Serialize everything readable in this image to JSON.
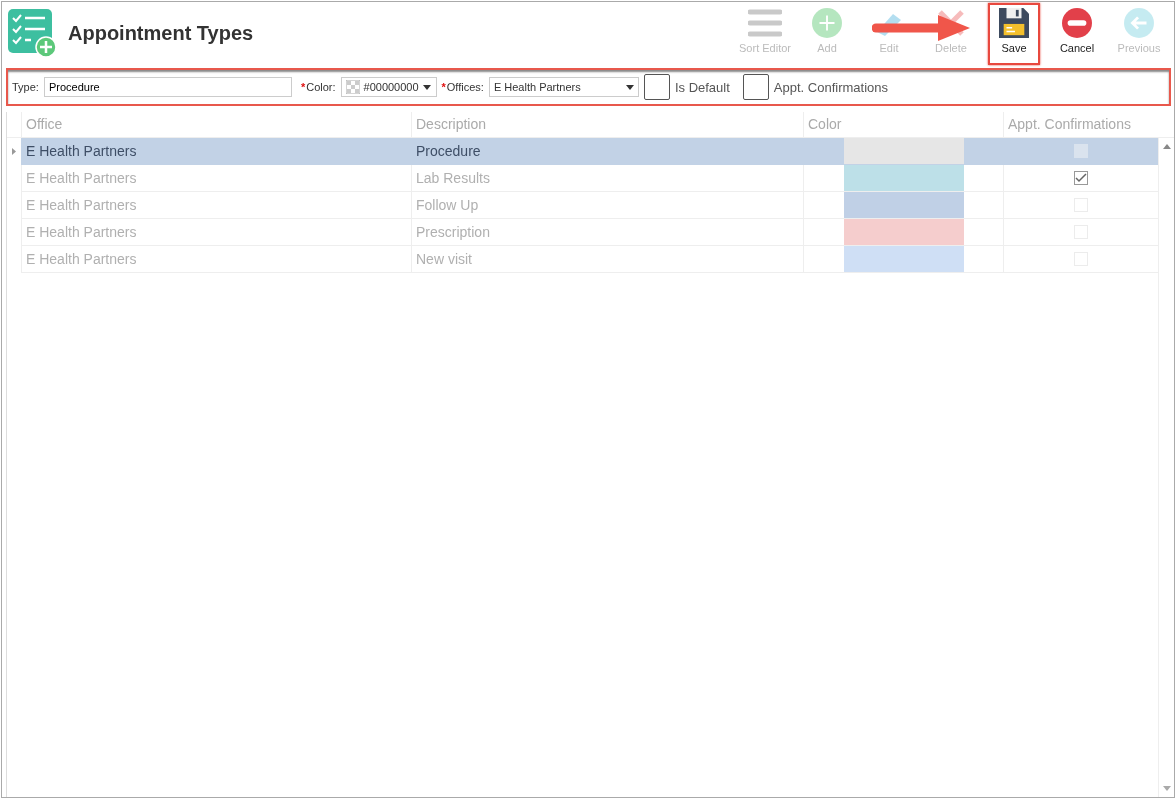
{
  "window": {
    "title": "Appointment Types"
  },
  "toolbar": [
    {
      "kind": "sort",
      "label": "Sort Editor",
      "disabled": true,
      "highlighted": false
    },
    {
      "kind": "add",
      "label": "Add",
      "disabled": true,
      "highlighted": false
    },
    {
      "kind": "edit",
      "label": "Edit",
      "disabled": true,
      "highlighted": false
    },
    {
      "kind": "delete",
      "label": "Delete",
      "disabled": true,
      "highlighted": false
    },
    {
      "kind": "save",
      "label": "Save",
      "disabled": false,
      "highlighted": true
    },
    {
      "kind": "cancel",
      "label": "Cancel",
      "disabled": false,
      "highlighted": false
    },
    {
      "kind": "previous",
      "label": "Previous",
      "disabled": true,
      "highlighted": false
    }
  ],
  "editor": {
    "type_label": "Type:",
    "type_value": "Procedure",
    "color_required": "*",
    "color_label": "Color:",
    "color_value": "#00000000",
    "offices_required": "*",
    "offices_label": "Offices:",
    "offices_value": "E Health Partners",
    "is_default": {
      "label": "Is Default",
      "checked": false
    },
    "confirmations": {
      "label": "Appt. Confirmations",
      "checked": false
    }
  },
  "table": {
    "columns": [
      "Office",
      "Description",
      "Color",
      "Appt. Confirmations"
    ],
    "rows": [
      {
        "office": "E Health Partners",
        "description": "Procedure",
        "color": "#e6e6e6",
        "confirmed": false,
        "selected": true
      },
      {
        "office": "E Health Partners",
        "description": "Lab Results",
        "color": "#bde0e8",
        "confirmed": true,
        "selected": false
      },
      {
        "office": "E Health Partners",
        "description": "Follow Up",
        "color": "#c0d0e6",
        "confirmed": false,
        "selected": false
      },
      {
        "office": "E Health Partners",
        "description": "Prescription",
        "color": "#f5cdcd",
        "confirmed": false,
        "selected": false
      },
      {
        "office": "E Health Partners",
        "description": "New visit",
        "color": "#cfdff5",
        "confirmed": false,
        "selected": false
      }
    ]
  }
}
